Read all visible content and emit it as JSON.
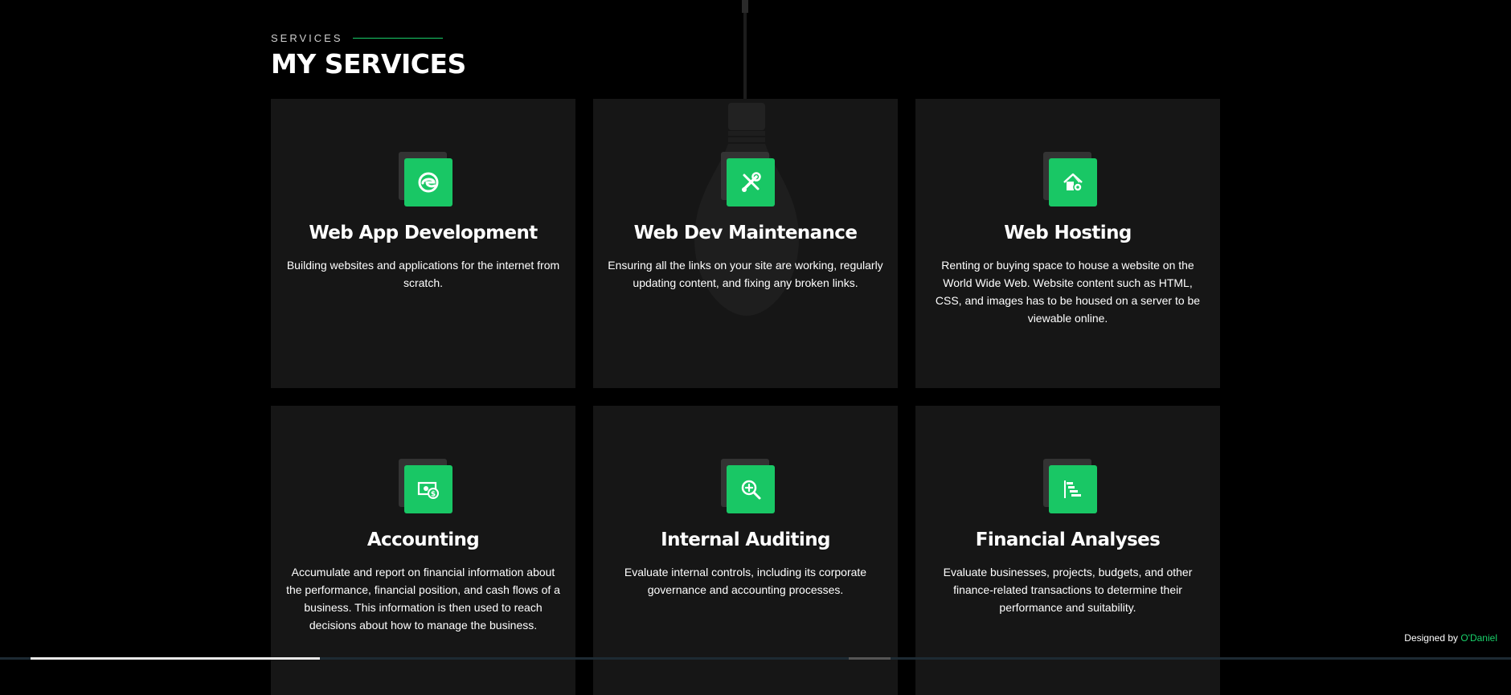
{
  "section": {
    "label": "SERVICES",
    "title": "MY SERVICES"
  },
  "services": [
    {
      "title": "Web App Development",
      "description": "Building websites and applications for the internet from scratch.",
      "icon": "edge-browser-icon"
    },
    {
      "title": "Web Dev Maintenance",
      "description": "Ensuring all the links on your site are working, regularly updating content, and fixing any broken links.",
      "icon": "tools-icon"
    },
    {
      "title": "Web Hosting",
      "description": "Renting or buying space to house a website on the World Wide Web. Website content such as HTML, CSS, and images has to be housed on a server to be viewable online.",
      "icon": "house-gear-icon"
    },
    {
      "title": "Accounting",
      "description": "Accumulate and report on financial information about the performance, financial position, and cash flows of a business. This information is then used to reach decisions about how to manage the business.",
      "icon": "cash-icon"
    },
    {
      "title": "Internal Auditing",
      "description": "Evaluate internal controls, including its corporate governance and accounting processes.",
      "icon": "zoom-in-icon"
    },
    {
      "title": "Financial Analyses",
      "description": "Evaluate businesses, projects, budgets, and other finance-related transactions to determine their performance and suitability.",
      "icon": "bar-chart-steps-icon"
    }
  ],
  "footer": {
    "designed_by": "Designed by ",
    "author": "O'Daniel"
  },
  "colors": {
    "accent": "#19c765",
    "background": "#000000",
    "card": "#161616"
  }
}
